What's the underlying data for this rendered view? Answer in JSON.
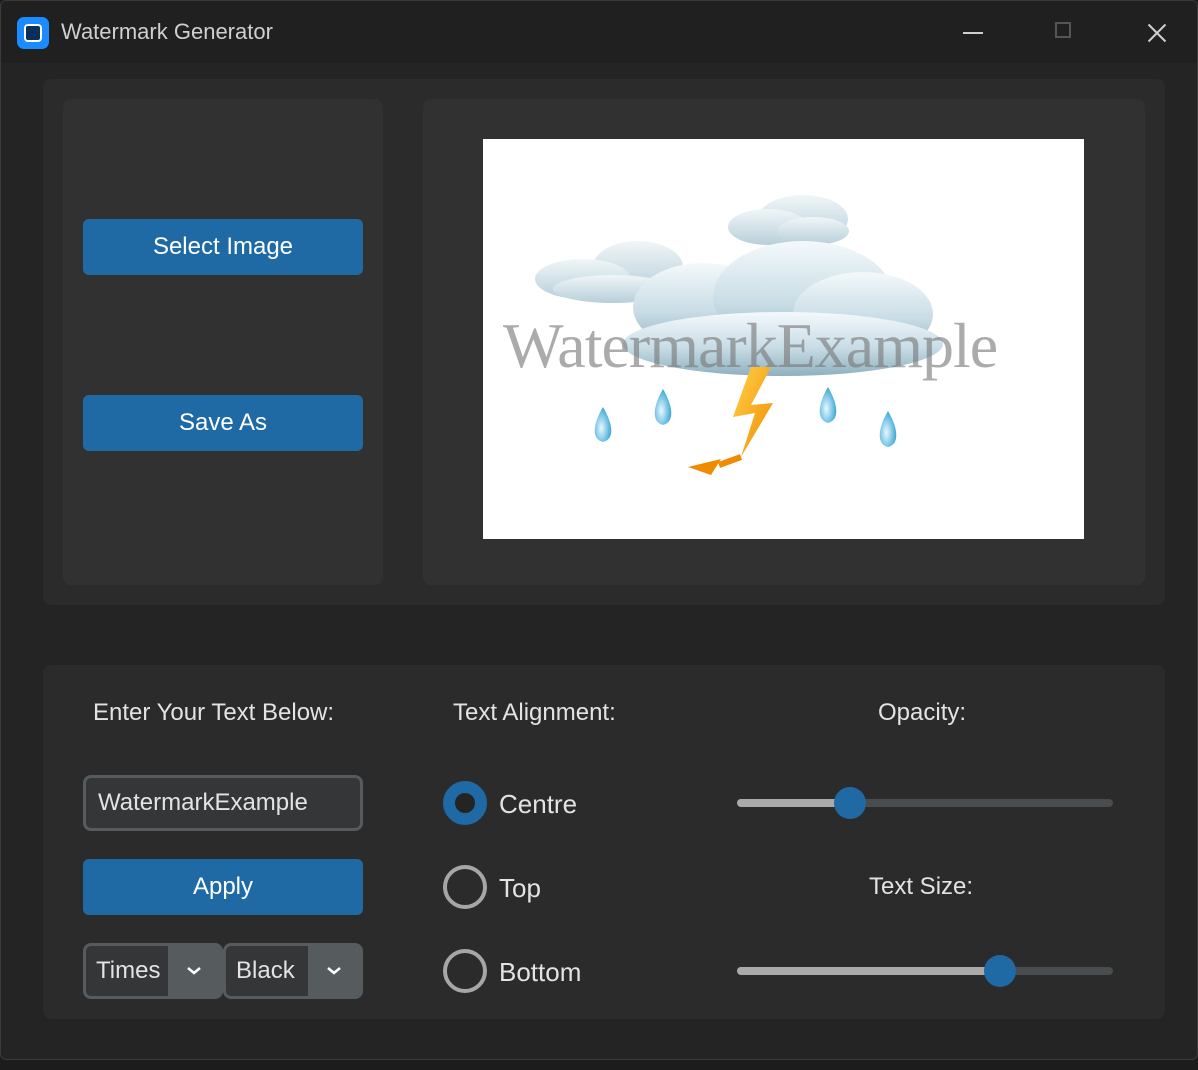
{
  "window": {
    "title": "Watermark Generator"
  },
  "controls_top": {
    "select_image_label": "Select Image",
    "save_as_label": "Save As"
  },
  "preview": {
    "watermark_text": "WatermarkExample"
  },
  "controls_bottom": {
    "text_label": "Enter Your Text Below:",
    "text_input_value": "WatermarkExample",
    "apply_label": "Apply",
    "font_selected": "Times",
    "color_selected": "Black",
    "alignment_label": "Text Alignment:",
    "alignment_options": [
      "Centre",
      "Top",
      "Bottom"
    ],
    "alignment_selected": "Centre",
    "opacity_label": "Opacity:",
    "opacity_value": 0.3,
    "text_size_label": "Text Size:",
    "text_size_value": 0.7
  },
  "colors": {
    "accent": "#1f6aa5",
    "background": "#242424",
    "panel": "#2b2b2b",
    "inner_panel": "#313131"
  }
}
